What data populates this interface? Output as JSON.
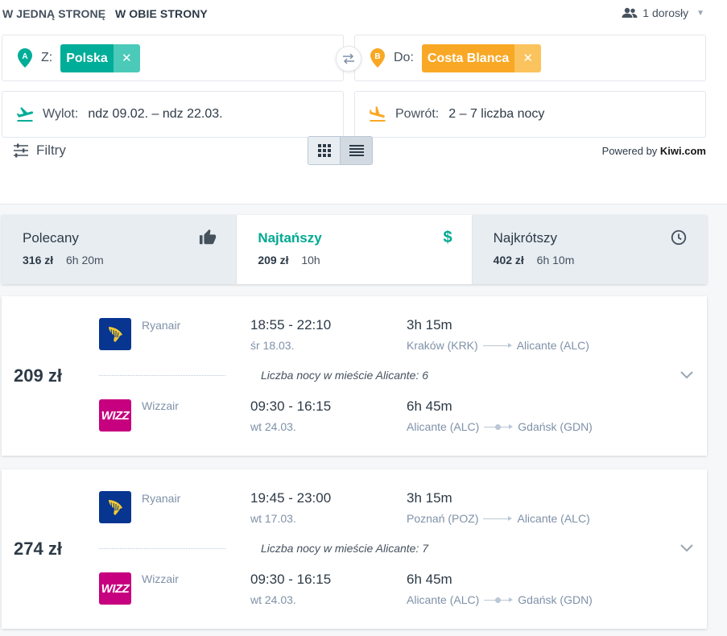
{
  "trip_type": {
    "one_way": "W JEDNĄ STRONĘ",
    "return": "W OBIE STRONY"
  },
  "passengers": "1 dorosły",
  "search": {
    "from_label": "Z:",
    "from_value": "Polska",
    "to_label": "Do:",
    "to_value": "Costa Blanca",
    "pin_a": "A",
    "pin_b": "B",
    "departure_label": "Wylot:",
    "departure_value": "ndz 09.02. – ndz 22.03.",
    "return_label": "Powrót:",
    "return_value": "2 – 7 liczba nocy"
  },
  "filters_label": "Filtry",
  "powered_by": {
    "prefix": "Powered by ",
    "brand": "Kiwi.com"
  },
  "sort_tabs": [
    {
      "title": "Polecany",
      "price": "316 zł",
      "duration": "6h 20m",
      "icon": "thumbs-up-icon"
    },
    {
      "title": "Najtańszy",
      "price": "209 zł",
      "duration": "10h",
      "icon": "dollar-icon"
    },
    {
      "title": "Najkrótszy",
      "price": "402 zł",
      "duration": "6h 10m",
      "icon": "clock-icon"
    }
  ],
  "results": [
    {
      "price": "209 zł",
      "nights_note": "Liczba nocy w mieście Alicante: 6",
      "outbound": {
        "carrier": "Ryanair",
        "times": "18:55 - 22:10",
        "date": "śr 18.03.",
        "duration": "3h 15m",
        "origin": "Kraków (KRK)",
        "destination": "Alicante (ALC)"
      },
      "inbound": {
        "carrier": "Wizzair",
        "times": "09:30 - 16:15",
        "date": "wt 24.03.",
        "duration": "6h 45m",
        "origin": "Alicante (ALC)",
        "destination": "Gdańsk (GDN)"
      }
    },
    {
      "price": "274 zł",
      "nights_note": "Liczba nocy w mieście Alicante: 7",
      "outbound": {
        "carrier": "Ryanair",
        "times": "19:45 - 23:00",
        "date": "wt 17.03.",
        "duration": "3h 15m",
        "origin": "Poznań (POZ)",
        "destination": "Alicante (ALC)"
      },
      "inbound": {
        "carrier": "Wizzair",
        "times": "09:30 - 16:15",
        "date": "wt 24.03.",
        "duration": "6h 45m",
        "origin": "Alicante (ALC)",
        "destination": "Gdańsk (GDN)"
      }
    }
  ],
  "wizz_logo_text": "WIZZ",
  "colors": {
    "accent": "#00ad98",
    "orange": "#f9a825",
    "ryanair": "#073590",
    "wizzair": "#c6007e"
  }
}
